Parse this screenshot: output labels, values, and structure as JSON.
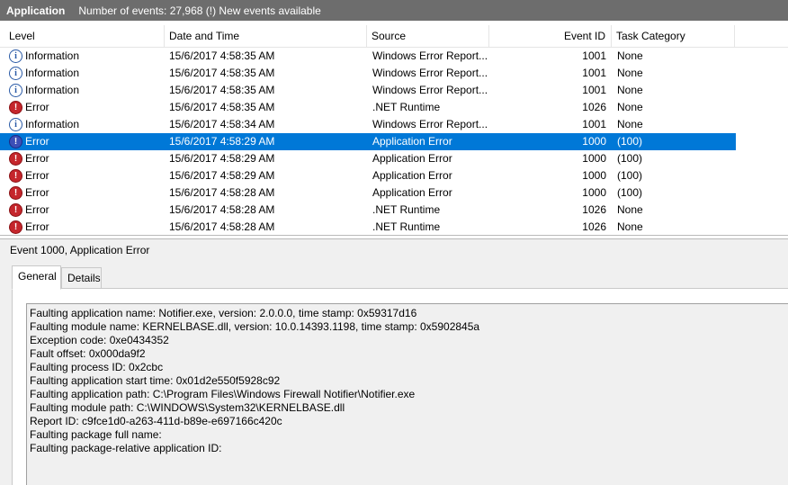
{
  "titlebar": {
    "app_name": "Application",
    "info": "Number of events: 27,968 (!) New events available"
  },
  "grid": {
    "columns": {
      "level": "Level",
      "date": "Date and Time",
      "source": "Source",
      "event_id": "Event ID",
      "category": "Task Category"
    },
    "rows": [
      {
        "level": "Information",
        "icon": "info-icon",
        "date": "15/6/2017 4:58:35 AM",
        "source": "Windows Error Report...",
        "event_id": "1001",
        "category": "None"
      },
      {
        "level": "Information",
        "icon": "info-icon",
        "date": "15/6/2017 4:58:35 AM",
        "source": "Windows Error Report...",
        "event_id": "1001",
        "category": "None"
      },
      {
        "level": "Information",
        "icon": "info-icon",
        "date": "15/6/2017 4:58:35 AM",
        "source": "Windows Error Report...",
        "event_id": "1001",
        "category": "None"
      },
      {
        "level": "Error",
        "icon": "error-icon",
        "date": "15/6/2017 4:58:35 AM",
        "source": ".NET Runtime",
        "event_id": "1026",
        "category": "None"
      },
      {
        "level": "Information",
        "icon": "info-icon",
        "date": "15/6/2017 4:58:34 AM",
        "source": "Windows Error Report...",
        "event_id": "1001",
        "category": "None"
      },
      {
        "level": "Error",
        "icon": "error-icon",
        "date": "15/6/2017 4:58:29 AM",
        "source": "Application Error",
        "event_id": "1000",
        "category": "(100)",
        "selected": true
      },
      {
        "level": "Error",
        "icon": "error-icon",
        "date": "15/6/2017 4:58:29 AM",
        "source": "Application Error",
        "event_id": "1000",
        "category": "(100)"
      },
      {
        "level": "Error",
        "icon": "error-icon",
        "date": "15/6/2017 4:58:29 AM",
        "source": "Application Error",
        "event_id": "1000",
        "category": "(100)"
      },
      {
        "level": "Error",
        "icon": "error-icon",
        "date": "15/6/2017 4:58:28 AM",
        "source": "Application Error",
        "event_id": "1000",
        "category": "(100)"
      },
      {
        "level": "Error",
        "icon": "error-icon",
        "date": "15/6/2017 4:58:28 AM",
        "source": ".NET Runtime",
        "event_id": "1026",
        "category": "None"
      },
      {
        "level": "Error",
        "icon": "error-icon",
        "date": "15/6/2017 4:58:28 AM",
        "source": ".NET Runtime",
        "event_id": "1026",
        "category": "None"
      }
    ]
  },
  "details": {
    "title": "Event 1000, Application Error",
    "tabs": {
      "general": "General",
      "details": "Details"
    },
    "message_lines": [
      "Faulting application name: Notifier.exe, version: 2.0.0.0, time stamp: 0x59317d16",
      "Faulting module name: KERNELBASE.dll, version: 10.0.14393.1198, time stamp: 0x5902845a",
      "Exception code: 0xe0434352",
      "Fault offset: 0x000da9f2",
      "Faulting process ID: 0x2cbc",
      "Faulting application start time: 0x01d2e550f5928c92",
      "Faulting application path: C:\\Program Files\\Windows Firewall Notifier\\Notifier.exe",
      "Faulting module path: C:\\WINDOWS\\System32\\KERNELBASE.dll",
      "Report ID: c9fce1d0-a263-411d-b89e-e697166c420c",
      "Faulting package full name:",
      "Faulting package-relative application ID:"
    ]
  },
  "colors": {
    "titlebar": "#6d6d6d",
    "selection": "#0078d7",
    "error": "#c5262c",
    "info": "#2a5aa6"
  }
}
